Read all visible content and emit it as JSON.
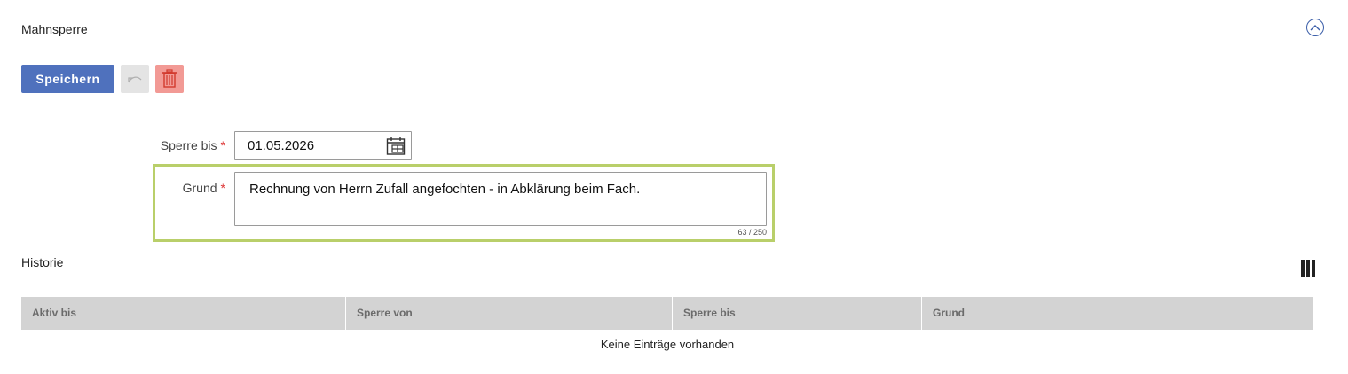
{
  "section": {
    "title": "Mahnsperre"
  },
  "toolbar": {
    "save_label": "Speichern"
  },
  "form": {
    "sperre_bis": {
      "label": "Sperre bis",
      "required_mark": "*",
      "value": "01.05.2026"
    },
    "grund": {
      "label": "Grund",
      "required_mark": "*",
      "value": "Rechnung von Herrn Zufall angefochten - in Abklärung beim Fach.",
      "counter": "63 / 250"
    }
  },
  "history": {
    "title": "Historie",
    "columns": [
      "Aktiv bis",
      "Sperre von",
      "Sperre bis",
      "Grund"
    ],
    "empty_text": "Keine Einträge vorhanden"
  },
  "colors": {
    "primary": "#4f71bd",
    "delete": "#f29a95",
    "focus_border": "#b9cf6a",
    "table_header": "#d3d3d3"
  },
  "icons": [
    "chevron-up-icon",
    "undo-icon",
    "trash-icon",
    "calendar-icon",
    "columns-icon"
  ]
}
